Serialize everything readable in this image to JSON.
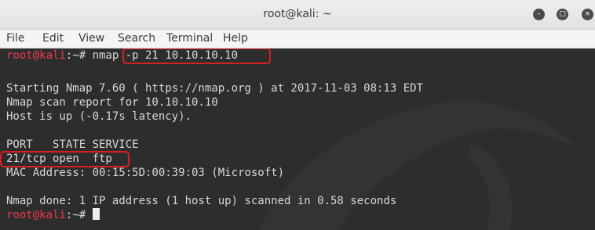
{
  "window": {
    "title": "root@kali: ~",
    "buttons": [
      "minimize-icon",
      "maximize-icon",
      "close-icon"
    ]
  },
  "menu": [
    "File",
    "Edit",
    "View",
    "Search",
    "Terminal",
    "Help"
  ],
  "terminal": {
    "prompt_user": "root@kali",
    "prompt_path": ":~# ",
    "command": "nmap -p 21 10.10.10.10",
    "output": [
      "Starting Nmap 7.60 ( https://nmap.org ) at 2017-11-03 08:13 EDT",
      "Nmap scan report for 10.10.10.10",
      "Host is up (-0.17s latency).",
      "PORT   STATE SERVICE",
      "21/tcp open  ftp",
      "MAC Address: 00:15:5D:00:39:03 (Microsoft)",
      "Nmap done: 1 IP address (1 host up) scanned in 0.58 seconds"
    ],
    "prompt2_user": "root@kali",
    "prompt2_path": ":~# "
  },
  "colors": {
    "prompt": "#f2384e",
    "text": "#d8d8d8",
    "background": "#2d2d2e",
    "highlight_box": "#d91f1f"
  }
}
